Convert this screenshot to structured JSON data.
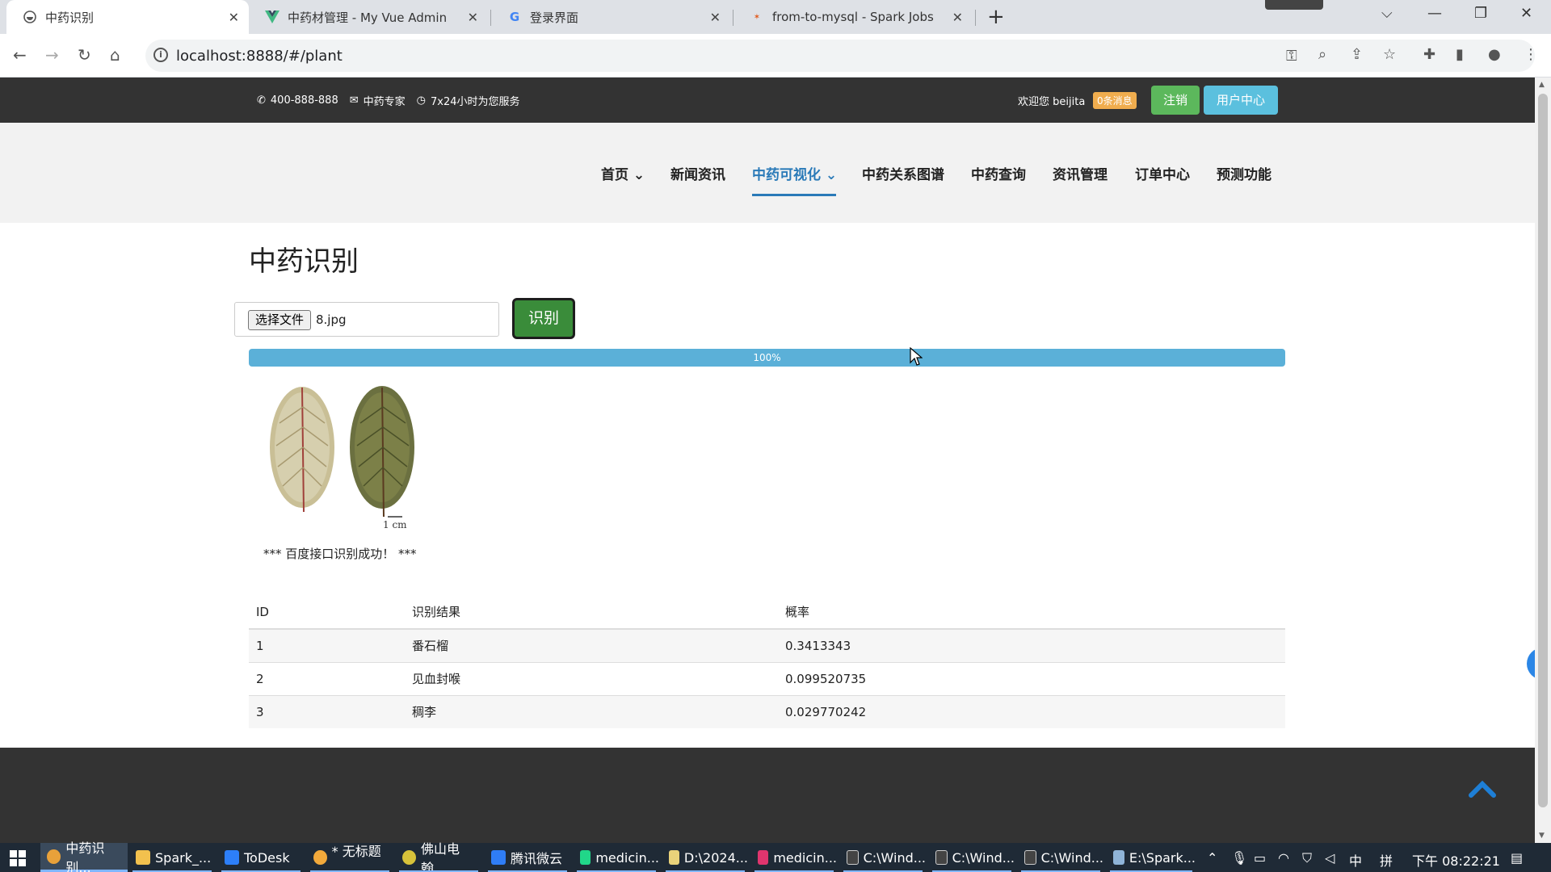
{
  "browser": {
    "tabs": [
      {
        "title": "中药识别",
        "icon": "globe-icon",
        "active": true
      },
      {
        "title": "中药材管理 - My Vue Admin",
        "icon": "vue-icon",
        "active": false
      },
      {
        "title": "登录界面",
        "icon": "google-icon",
        "active": false
      },
      {
        "title": "from-to-mysql - Spark Jobs",
        "icon": "spark-icon",
        "active": false
      }
    ],
    "url": "localhost:8888/#/plant"
  },
  "topbar": {
    "phone": "400-888-888",
    "expert": "中药专家",
    "service": "7x24小时为您服务",
    "welcome": "欢迎您 beijita",
    "messages": "0条消息",
    "logout": "注销",
    "user_center": "用户中心"
  },
  "nav": {
    "items": [
      {
        "label": "首页",
        "dropdown": true
      },
      {
        "label": "新闻资讯",
        "dropdown": false
      },
      {
        "label": "中药可视化",
        "dropdown": true,
        "active": true
      },
      {
        "label": "中药关系图谱",
        "dropdown": false
      },
      {
        "label": "中药查询",
        "dropdown": false
      },
      {
        "label": "资讯管理",
        "dropdown": false
      },
      {
        "label": "订单中心",
        "dropdown": false
      },
      {
        "label": "预测功能",
        "dropdown": false
      }
    ]
  },
  "main": {
    "title": "中药识别",
    "file_button": "选择文件",
    "file_name": "8.jpg",
    "identify_button": "识别",
    "progress": 100,
    "progress_label": "100%",
    "scale_label": "1 cm",
    "success_message": "*** 百度接口识别成功！ ***",
    "table": {
      "headers": [
        "ID",
        "识别结果",
        "概率"
      ],
      "rows": [
        [
          "1",
          "番石榴",
          "0.3413343"
        ],
        [
          "2",
          "见血封喉",
          "0.099520735"
        ],
        [
          "3",
          "稠李",
          "0.029770242"
        ]
      ]
    }
  },
  "taskbar": {
    "items": [
      "中药识别...",
      "Spark_...",
      "ToDesk",
      "* 无标题 ...",
      "佛山电翰...",
      "腾讯微云",
      "medicin...",
      "D:\\2024...",
      "medicin...",
      "C:\\Wind...",
      "C:\\Wind...",
      "C:\\Wind...",
      "E:\\Spark..."
    ],
    "ime": "中",
    "ime2": "拼",
    "clock": "下午 08:22:21"
  },
  "colors": {
    "accent_blue": "#2a7ab8",
    "progress": "#5bb0d8",
    "success_green": "#5cb85c",
    "info_blue": "#5bc0de",
    "badge_orange": "#f0ad4e",
    "identify_green": "#3a8c3a"
  }
}
